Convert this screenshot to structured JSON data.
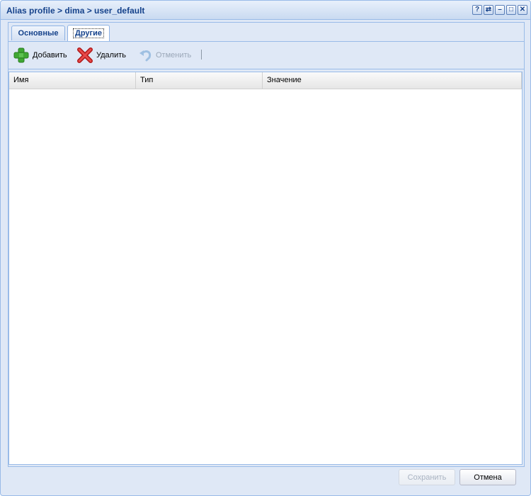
{
  "window": {
    "title": "Alias profile > dima > user_default",
    "tools": [
      "?",
      "⇄",
      "–",
      "□",
      "✕"
    ]
  },
  "tabs": [
    {
      "label": "Основные",
      "active": false
    },
    {
      "label": "Другие",
      "active": true
    }
  ],
  "toolbar": {
    "add_label": "Добавить",
    "delete_label": "Удалить",
    "undo_label": "Отменить",
    "separator": "|"
  },
  "grid": {
    "columns": [
      "Имя",
      "Тип",
      "Значение"
    ],
    "rows": []
  },
  "footer": {
    "save_label": "Сохранить",
    "cancel_label": "Отмена"
  }
}
